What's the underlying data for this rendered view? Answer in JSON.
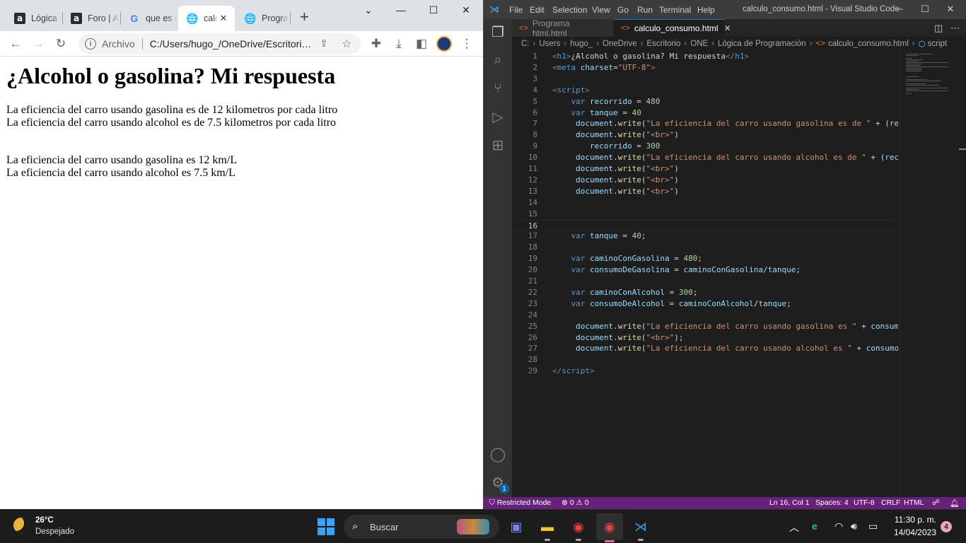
{
  "chrome": {
    "tabs": [
      {
        "label": "Lógica de programación",
        "icon": "alura-icon"
      },
      {
        "label": "Foro | Alura",
        "icon": "alura-icon"
      },
      {
        "label": "que es una variable",
        "icon": "google-icon"
      },
      {
        "label": "calculo_consumo.html",
        "icon": "globe-icon"
      },
      {
        "label": "Programa html.html",
        "icon": "globe-icon"
      }
    ],
    "new_tab": "+",
    "address": {
      "prefix": "Archivo",
      "url": "C:/Users/hugo_/OneDrive/Escritorio/ONE/Lógica de Programación/calculo_consumo.html"
    },
    "page": {
      "heading": "¿Alcohol o gasolina? Mi respuesta",
      "lines": [
        "La eficiencia del carro usando gasolina es de 12 kilometros por cada litro",
        "La eficiencia del carro usando alcohol es de 7.5 kilometros por cada litro",
        "La eficiencia del carro usando gasolina es 12 km/L",
        "La eficiencia del carro usando alcohol es 7.5 km/L"
      ]
    }
  },
  "vscode": {
    "menu": [
      "File",
      "Edit",
      "Selection",
      "View",
      "Go",
      "Run",
      "Terminal",
      "Help"
    ],
    "window_title": "calculo_consumo.html - Visual Studio Code",
    "tabs": [
      {
        "label": "Programa html.html",
        "active": false
      },
      {
        "label": "calculo_consumo.html",
        "active": true
      }
    ],
    "breadcrumbs": [
      "C:",
      "Users",
      "hugo_",
      "OneDrive",
      "Escritorio",
      "ONE",
      "Lógica de Programación",
      "calculo_consumo.html",
      "script"
    ],
    "code_lines": [
      {
        "n": "1",
        "html": "<span class='punc'>&lt;</span><span class='tag'>h1</span><span class='punc'>&gt;</span>¿Alcohol o gasolina? Mi respuesta<span class='punc'>&lt;/</span><span class='tag'>h1</span><span class='punc'>&gt;</span>"
      },
      {
        "n": "2",
        "html": "<span class='punc'>&lt;</span><span class='tag'>meta</span> <span class='attr'>charset</span>=<span class='str'>\"UTF-8\"</span><span class='punc'>&gt;</span>"
      },
      {
        "n": "3",
        "html": ""
      },
      {
        "n": "4",
        "html": "<span class='punc'>&lt;</span><span class='tag'>script</span><span class='punc'>&gt;</span>"
      },
      {
        "n": "5",
        "html": "    <span class='kw'>var</span> <span class='var'>recorrido</span> = <span class='num'>480</span>"
      },
      {
        "n": "6",
        "html": "    <span class='kw'>var</span> <span class='var'>tanque</span> = <span class='num'>40</span>"
      },
      {
        "n": "7",
        "html": "     <span class='var'>document</span>.<span class='fn'>write</span>(<span class='str'>\"La eficiencia del carro usando gasolina es de \"</span> + (<span class='var'>recorrido</span>/<span class='var'>tanque</span>)"
      },
      {
        "n": "8",
        "html": "     <span class='var'>document</span>.<span class='fn'>write</span>(<span class='str'>\"&lt;br&gt;\"</span>)"
      },
      {
        "n": "9",
        "html": "        <span class='var'>recorrido</span> = <span class='num'>300</span>"
      },
      {
        "n": "10",
        "html": "     <span class='var'>document</span>.<span class='fn'>write</span>(<span class='str'>\"La eficiencia del carro usando alcohol es de \"</span> + (<span class='var'>recorrido</span>/<span class='var'>tanque</span>)"
      },
      {
        "n": "11",
        "html": "     <span class='var'>document</span>.<span class='fn'>write</span>(<span class='str'>\"&lt;br&gt;\"</span>)"
      },
      {
        "n": "12",
        "html": "     <span class='var'>document</span>.<span class='fn'>write</span>(<span class='str'>\"&lt;br&gt;\"</span>)"
      },
      {
        "n": "13",
        "html": "     <span class='var'>document</span>.<span class='fn'>write</span>(<span class='str'>\"&lt;br&gt;\"</span>)"
      },
      {
        "n": "14",
        "html": ""
      },
      {
        "n": "15",
        "html": ""
      },
      {
        "n": "16",
        "html": ""
      },
      {
        "n": "17",
        "html": "    <span class='kw'>var</span> <span class='var'>tanque</span> = <span class='num'>40</span>;"
      },
      {
        "n": "18",
        "html": ""
      },
      {
        "n": "19",
        "html": "    <span class='kw'>var</span> <span class='var'>caminoConGasolina</span> = <span class='num'>480</span>;"
      },
      {
        "n": "20",
        "html": "    <span class='kw'>var</span> <span class='var'>consumoDeGasolina</span> = <span class='var'>caminoConGasolina</span>/<span class='var'>tanque</span>;"
      },
      {
        "n": "21",
        "html": ""
      },
      {
        "n": "22",
        "html": "    <span class='kw'>var</span> <span class='var'>caminoConAlcohol</span> = <span class='num'>300</span>;"
      },
      {
        "n": "23",
        "html": "    <span class='kw'>var</span> <span class='var'>consumoDeAlcohol</span> = <span class='var'>caminoConAlcohol</span>/<span class='var'>tanque</span>;"
      },
      {
        "n": "24",
        "html": ""
      },
      {
        "n": "25",
        "html": "     <span class='var'>document</span>.<span class='fn'>write</span>(<span class='str'>\"La eficiencia del carro usando gasolina es \"</span> + <span class='var'>consumoDeGasolina</span>"
      },
      {
        "n": "26",
        "html": "     <span class='var'>document</span>.<span class='fn'>write</span>(<span class='str'>\"&lt;br&gt;\"</span>);"
      },
      {
        "n": "27",
        "html": "     <span class='var'>document</span>.<span class='fn'>write</span>(<span class='str'>\"La eficiencia del carro usando alcohol es \"</span> + <span class='var'>consumoDeAlcohol</span>"
      },
      {
        "n": "28",
        "html": ""
      },
      {
        "n": "29",
        "html": "<span class='punc'>&lt;/</span><span class='tag'>script</span><span class='punc'>&gt;</span>"
      }
    ],
    "current_line": "16",
    "status": {
      "restricted": "Restricted Mode",
      "errors": "0",
      "warnings": "0",
      "position": "Ln 16, Col 1",
      "spaces": "Spaces: 4",
      "encoding": "UTF-8",
      "eol": "CRLF",
      "language": "HTML"
    },
    "accounts_badge": "1"
  },
  "taskbar": {
    "weather": {
      "temp": "26°C",
      "desc": "Despejado"
    },
    "search_placeholder": "Buscar",
    "time": "11:30 p. m.",
    "date": "14/04/2023",
    "notifications": "4"
  }
}
